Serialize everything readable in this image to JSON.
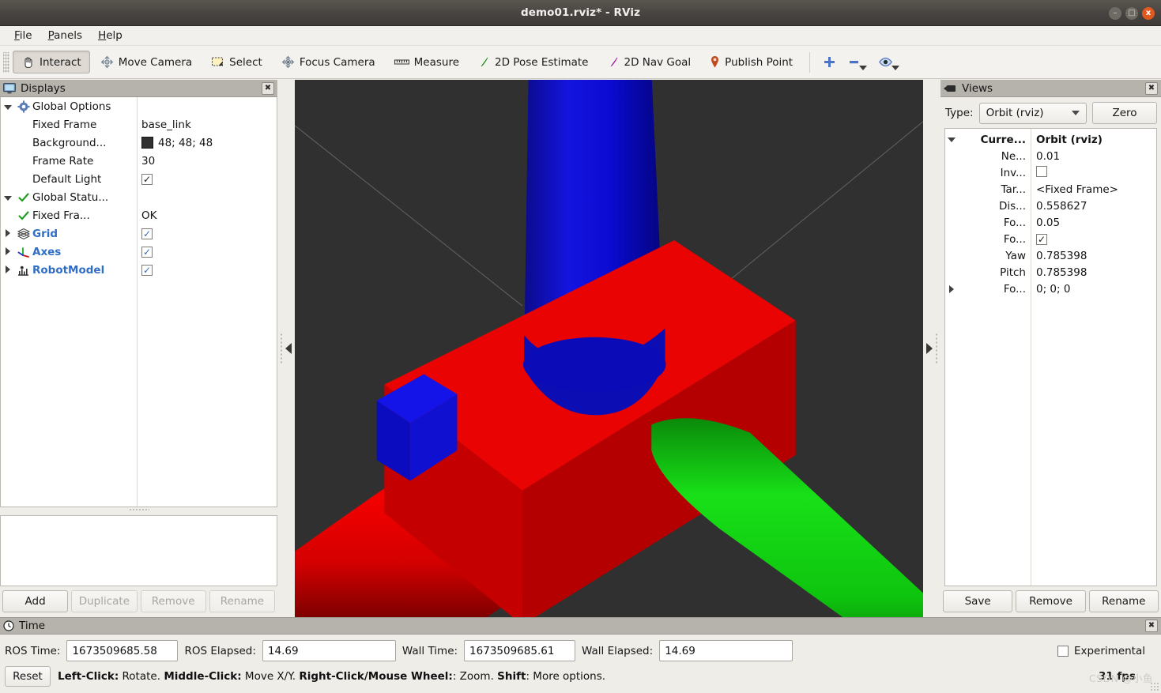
{
  "window": {
    "title": "demo01.rviz* - RViz",
    "controls": {
      "minimize": "–",
      "maximize": "□",
      "close": "x"
    }
  },
  "menubar": {
    "items": [
      {
        "label": "File",
        "mnemonic": "F"
      },
      {
        "label": "Panels",
        "mnemonic": "P"
      },
      {
        "label": "Help",
        "mnemonic": "H"
      }
    ]
  },
  "toolbar": {
    "buttons": [
      {
        "label": "Interact",
        "icon": "hand-cursor-icon",
        "active": true
      },
      {
        "label": "Move Camera",
        "icon": "move-camera-icon",
        "active": false
      },
      {
        "label": "Select",
        "icon": "select-rect-icon",
        "active": false
      },
      {
        "label": "Focus Camera",
        "icon": "focus-camera-icon",
        "active": false
      },
      {
        "label": "Measure",
        "icon": "ruler-icon",
        "active": false
      },
      {
        "label": "2D Pose Estimate",
        "icon": "green-arrow-icon",
        "active": false
      },
      {
        "label": "2D Nav Goal",
        "icon": "magenta-arrow-icon",
        "active": false
      },
      {
        "label": "Publish Point",
        "icon": "map-pin-icon",
        "active": false
      }
    ],
    "extras": [
      {
        "name": "zoom-in-icon",
        "glyph": "+"
      },
      {
        "name": "zoom-out-icon",
        "glyph": "–"
      },
      {
        "name": "eye-visibility-icon",
        "glyph": "eye"
      }
    ]
  },
  "displays": {
    "panel_title": "Displays",
    "close_label": "✖",
    "rows": [
      {
        "expander": "down",
        "icon": "gear-icon",
        "label": "Global Options",
        "value_type": "none",
        "value": "",
        "bold": false,
        "indent": 0
      },
      {
        "expander": "none",
        "icon": "none",
        "label": "Fixed Frame",
        "value_type": "text",
        "value": "base_link",
        "bold": false,
        "indent": 1
      },
      {
        "expander": "none",
        "icon": "none",
        "label": "Background...",
        "value_type": "color",
        "value": "48; 48; 48",
        "color": "#303030",
        "bold": false,
        "indent": 1
      },
      {
        "expander": "none",
        "icon": "none",
        "label": "Frame Rate",
        "value_type": "text",
        "value": "30",
        "bold": false,
        "indent": 1
      },
      {
        "expander": "none",
        "icon": "none",
        "label": "Default Light",
        "value_type": "checkbox",
        "value": "checked",
        "bold": false,
        "indent": 1
      },
      {
        "expander": "down",
        "icon": "check-icon",
        "label": "Global Statu...",
        "value_type": "none",
        "value": "",
        "bold": false,
        "indent": 0
      },
      {
        "expander": "none",
        "icon": "check-icon",
        "label": "Fixed Fra...",
        "value_type": "text",
        "value": "OK",
        "bold": false,
        "indent": 1
      },
      {
        "expander": "right",
        "icon": "grid-icon",
        "label": "Grid",
        "value_type": "checkbox",
        "value": "checked",
        "bold": true,
        "indent": 0
      },
      {
        "expander": "right",
        "icon": "axes-icon",
        "label": "Axes",
        "value_type": "checkbox",
        "value": "checked",
        "bold": true,
        "indent": 0
      },
      {
        "expander": "right",
        "icon": "robot-icon",
        "label": "RobotModel",
        "value_type": "checkbox",
        "value": "checked",
        "bold": true,
        "indent": 0
      }
    ],
    "buttons": [
      {
        "label": "Add",
        "enabled": true
      },
      {
        "label": "Duplicate",
        "enabled": false
      },
      {
        "label": "Remove",
        "enabled": false
      },
      {
        "label": "Rename",
        "enabled": false
      }
    ]
  },
  "views": {
    "panel_title": "Views",
    "close_label": "✖",
    "type_label": "Type:",
    "type_value": "Orbit (rviz)",
    "zero_label": "Zero",
    "rows": [
      {
        "expander": "down",
        "key": "Curre...",
        "value": "Orbit (rviz)",
        "type": "text",
        "bold": true
      },
      {
        "expander": "none",
        "key": "Ne...",
        "value": "0.01",
        "type": "text",
        "bold": false
      },
      {
        "expander": "none",
        "key": "Inv...",
        "value": "unchecked",
        "type": "checkbox",
        "bold": false
      },
      {
        "expander": "none",
        "key": "Tar...",
        "value": "<Fixed Frame>",
        "type": "text",
        "bold": false
      },
      {
        "expander": "none",
        "key": "Dis...",
        "value": "0.558627",
        "type": "text",
        "bold": false
      },
      {
        "expander": "none",
        "key": "Fo...",
        "value": "0.05",
        "type": "text",
        "bold": false
      },
      {
        "expander": "none",
        "key": "Fo...",
        "value": "checked",
        "type": "checkbox",
        "bold": false
      },
      {
        "expander": "none",
        "key": "Yaw",
        "value": "0.785398",
        "type": "text",
        "bold": false
      },
      {
        "expander": "none",
        "key": "Pitch",
        "value": "0.785398",
        "type": "text",
        "bold": false
      },
      {
        "expander": "right",
        "key": "Fo...",
        "value": "0; 0; 0",
        "type": "text",
        "bold": false
      }
    ],
    "buttons": [
      {
        "label": "Save"
      },
      {
        "label": "Remove"
      },
      {
        "label": "Rename"
      }
    ]
  },
  "viewport": {
    "background_color": "#303030",
    "grid_line_color": "#8f8f8f",
    "objects": [
      {
        "name": "base-box",
        "color": "#e00000"
      },
      {
        "name": "z-cylinder",
        "color": "#0000e8"
      },
      {
        "name": "x-cylinder",
        "color": "#ee0000"
      },
      {
        "name": "y-cylinder",
        "color": "#00c800"
      },
      {
        "name": "small-box",
        "color": "#1414e8"
      }
    ]
  },
  "time": {
    "panel_title": "Time",
    "close_label": "✖",
    "fields": [
      {
        "label": "ROS Time:",
        "value": "1673509685.58"
      },
      {
        "label": "ROS Elapsed:",
        "value": "14.69"
      },
      {
        "label": "Wall Time:",
        "value": "1673509685.61"
      },
      {
        "label": "Wall Elapsed:",
        "value": "14.69"
      }
    ],
    "experimental_label": "Experimental",
    "experimental_checked": false,
    "reset_label": "Reset",
    "hint_parts": [
      {
        "text": "Left-Click:",
        "bold": true
      },
      {
        "text": " Rotate. ",
        "bold": false
      },
      {
        "text": "Middle-Click:",
        "bold": true
      },
      {
        "text": " Move X/Y. ",
        "bold": false
      },
      {
        "text": "Right-Click/Mouse Wheel:",
        "bold": true
      },
      {
        "text": ": Zoom. ",
        "bold": false
      },
      {
        "text": "Shift",
        "bold": true
      },
      {
        "text": ": More options.",
        "bold": false
      }
    ],
    "fps": "31 fps",
    "watermark": "CSDN @小鱼"
  }
}
